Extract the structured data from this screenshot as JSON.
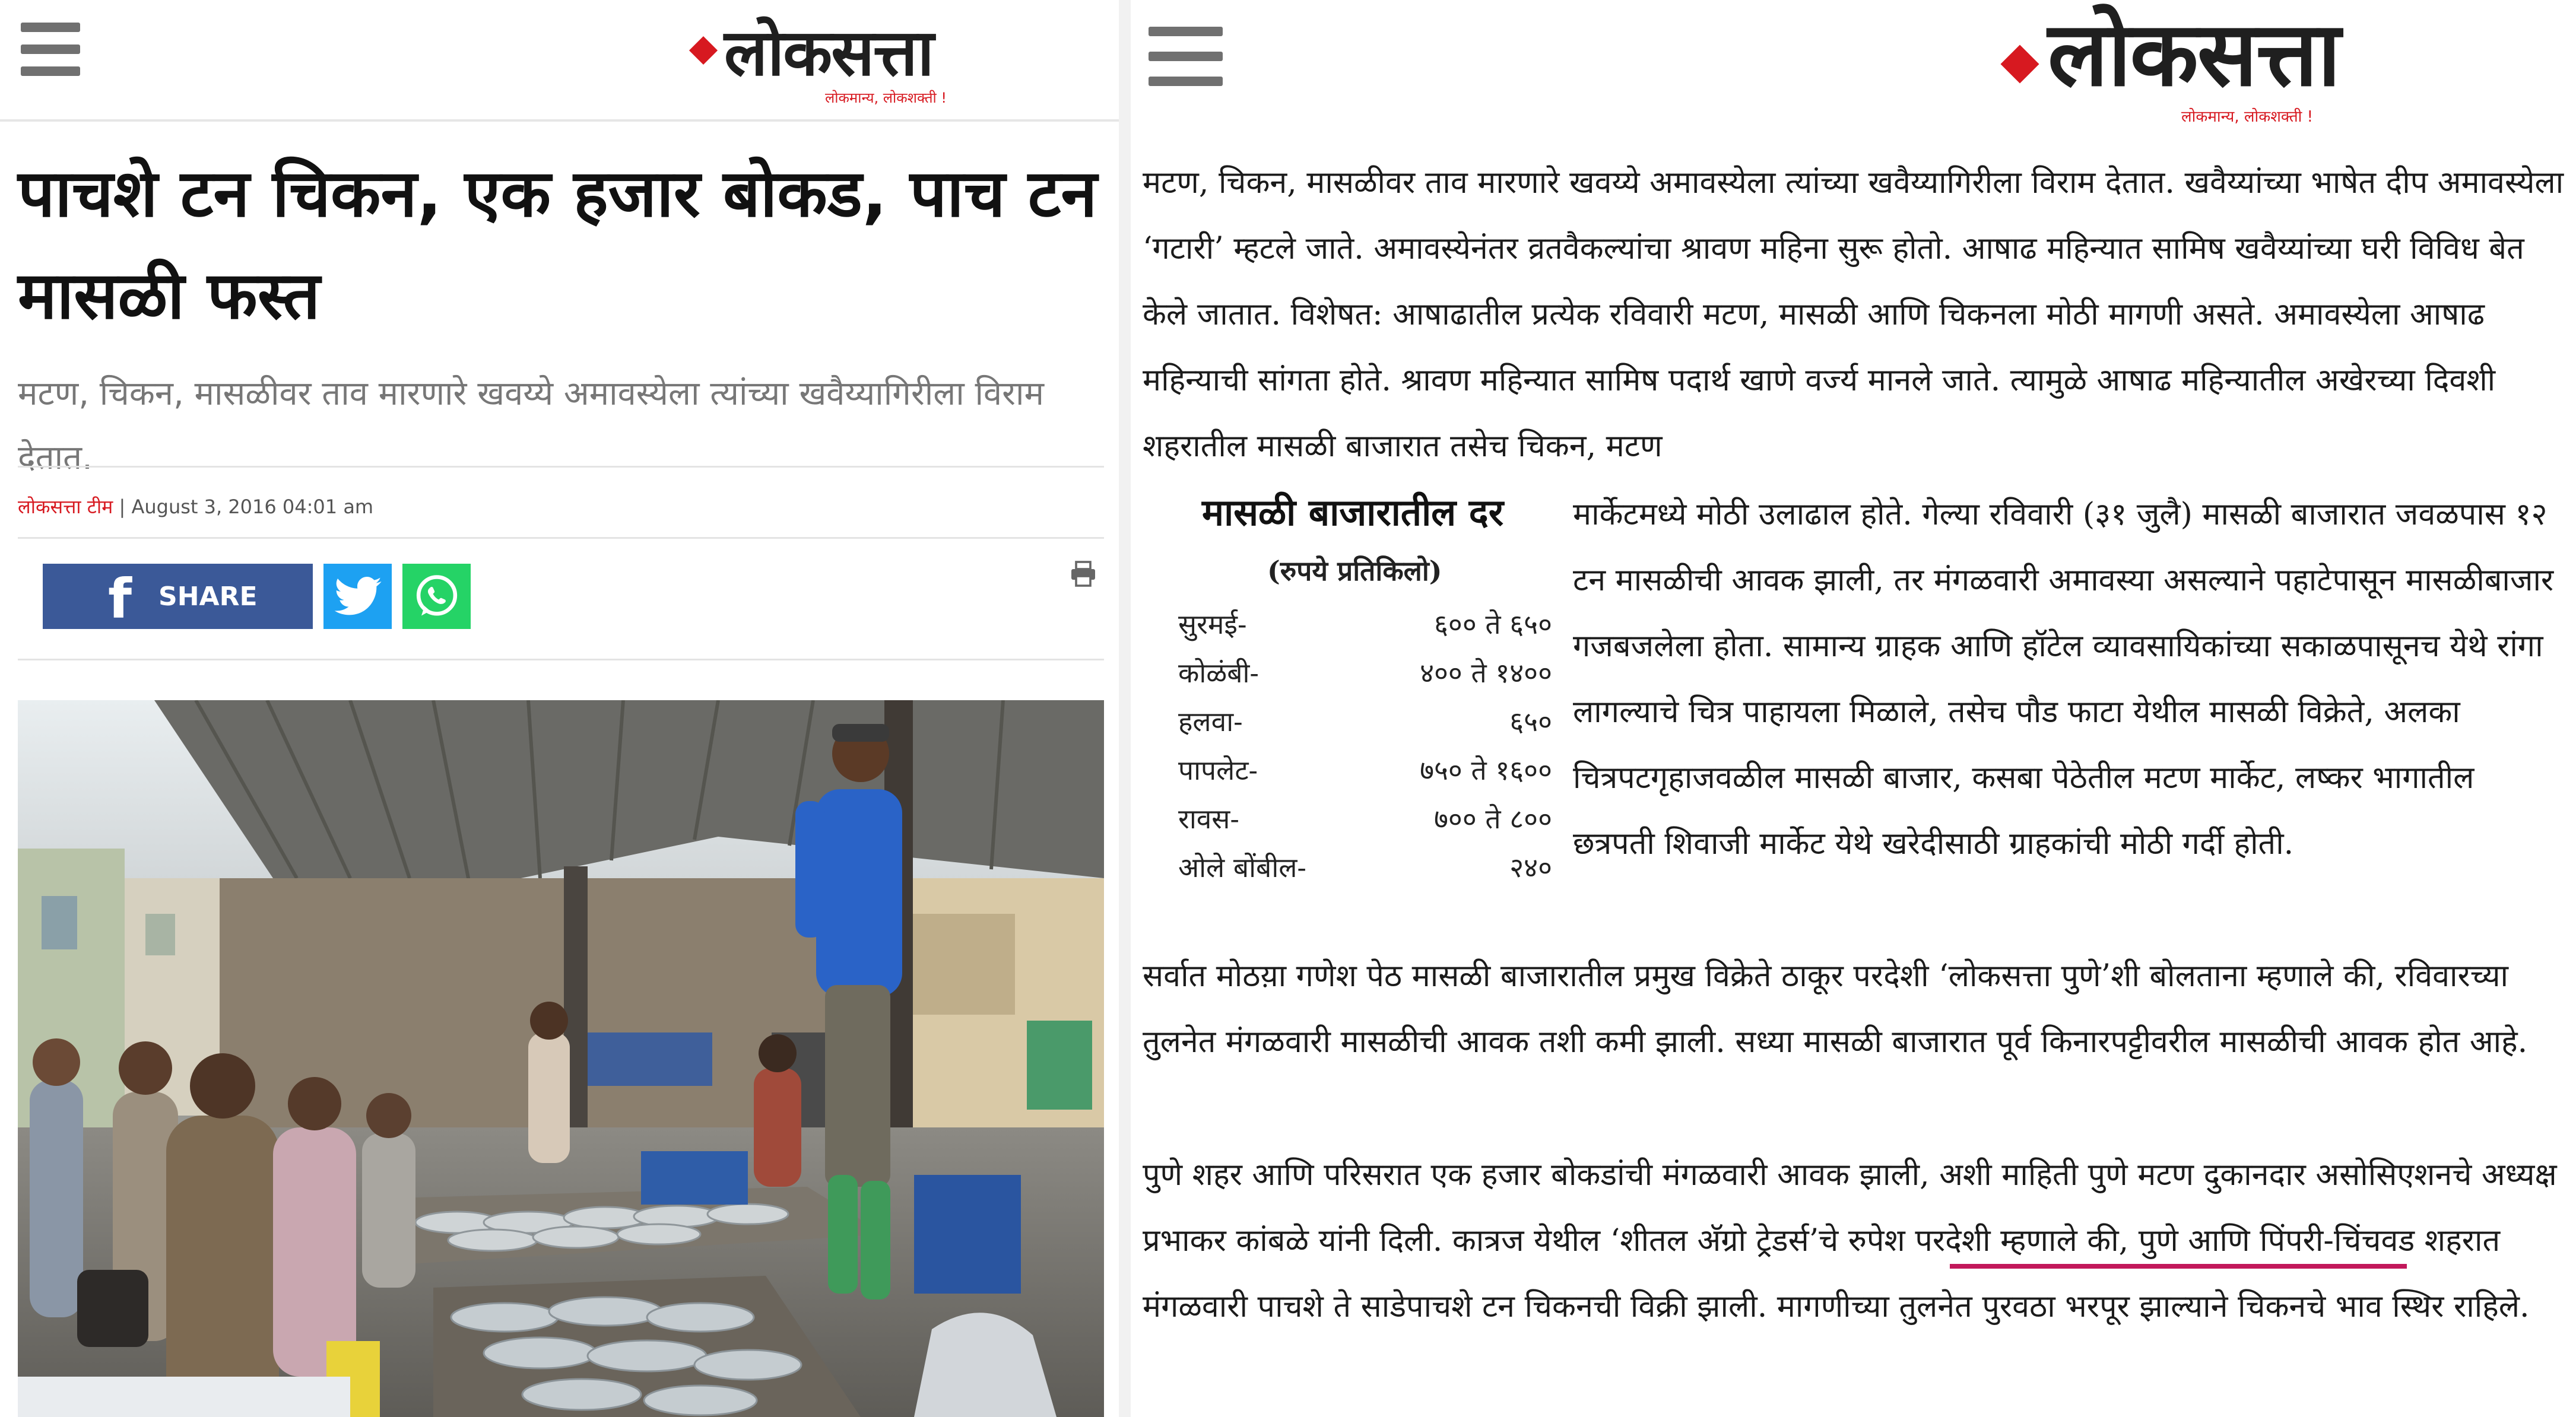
{
  "left": {
    "logo": {
      "wordmark": "लोकसत्ता",
      "tagline": "लोकमान्य, लोकशक्ती !"
    },
    "article": {
      "headline": "पाचशे टन चिकन, एक हजार बोकड, पाच टन मासळी फस्त",
      "summary": "मटण, चिकन, मासळीवर ताव मारणारे खवय्ये अमावस्येला त्यांच्या खवैय्यागिरीला विराम देतात.",
      "author": "लोकसत्ता टीम",
      "separator": " | ",
      "date": "August 3, 2016 04:01 am"
    },
    "share": {
      "facebook_label": "SHARE",
      "facebook_letter": "f"
    }
  },
  "right": {
    "logo": {
      "wordmark": "लोकसत्ता",
      "tagline": "लोकमान्य, लोकशक्ती !"
    },
    "para1_top": "मटण, चिकन, मासळीवर ताव मारणारे खवय्ये अमावस्येला त्यांच्या खवैय्यागिरीला विराम देतात. खवैय्यांच्या भाषेत दीप अमावस्येला ‘गटारी’ म्हटले जाते. अमावस्येनंतर व्रतवैकल्यांचा श्रावण महिना सुरू होतो. आषाढ महिन्यात सामिष खवैय्यांच्या घरी विविध बेत केले जातात. विशेषत: आषाढातील प्रत्येक रविवारी मटण, मासळी आणि चिकनला मोठी मागणी असते. अमावस्येला आषाढ महिन्याची सांगता होते. श्रावण महिन्यात सामिष पदार्थ खाणे वर्ज्य मानले जाते. त्यामुळे आषाढ महिन्यातील अखेरच्या दिवशी शहरातील मासळी बाजारात तसेच चिकन, मटण",
    "para1_wrap": "मार्केटमध्ये मोठी उलाढाल होते. गेल्या रविवारी (३१ जुलै) मासळी बाजारात जवळपास १२ टन मासळीची आवक झाली, तर मंगळवारी अमावस्या असल्याने पहाटेपासून मासळीबाजार गजबजलेला होता. सामान्य ग्राहक आणि हॉटेल व्यावसायिकांच्या सकाळपासूनच येथे रांगा लागल्याचे चित्र पाहायला मिळाले, तसेच पौड फाटा येथील मासळी विक्रेते, अलका चित्रपटगृहाजवळील मासळी बाजार, कसबा पेठेतील मटण मार्केट, लष्कर भागातील छत्रपती शिवाजी मार्केट येथे खरेदीसाठी ग्राहकांची मोठी गर्दी होती.",
    "para2": "सर्वात मोठय़ा गणेश पेठ मासळी बाजारातील प्रमुख विक्रेते ठाकूर परदेशी ‘लोकसत्ता पुणे’शी बोलताना म्हणाले की, रविवारच्या तुलनेत मंगळवारी मासळीची आवक तशी कमी झाली. सध्या मासळी बाजारात पूर्व किनारपट्टीवरील मासळीची आवक होत आहे.",
    "para3": "पुणे शहर आणि परिसरात एक हजार बोकडांची मंगळवारी आवक झाली, अशी माहिती पुणे मटण दुकानदार असोसिएशनचे अध्यक्ष प्रभाकर कांबळे यांनी दिली. कात्रज येथील ‘शीतल अ‍ॅग्रो ट्रेडर्स’चे रुपेश परदेशी म्हणाले की, पुणे आणि पिंपरी-चिंचवड शहरात मंगळवारी पाचशे ते साडेपाचशे टन चिकनची विक्री झाली. मागणीच्या तुलनेत पुरवठा भरपूर झाल्याने चिकनचे भाव स्थिर राहिले.",
    "rates_box": {
      "title": "मासळी बाजारातील दर",
      "unit": "(रुपये प्रतिकिलो)",
      "rows": [
        {
          "name": "सुरमई-",
          "value": "६०० ते ६५०"
        },
        {
          "name": "कोळंबी-",
          "value": "४०० ते १४००"
        },
        {
          "name": "हलवा-",
          "value": "६५०"
        },
        {
          "name": "पापलेट-",
          "value": "७५० ते १६००"
        },
        {
          "name": "रावस-",
          "value": "७०० ते ८००"
        },
        {
          "name": "ओले बोंबील-",
          "value": "२४०"
        }
      ]
    }
  },
  "colors": {
    "brand_red": "#d71920",
    "facebook": "#3b5998",
    "twitter": "#1da1f2",
    "whatsapp": "#25d366",
    "underline": "#c2185b"
  },
  "icons": [
    "hamburger-menu-icon",
    "logo-diamond-icon",
    "facebook-icon",
    "twitter-bird-icon",
    "whatsapp-icon",
    "print-icon"
  ]
}
